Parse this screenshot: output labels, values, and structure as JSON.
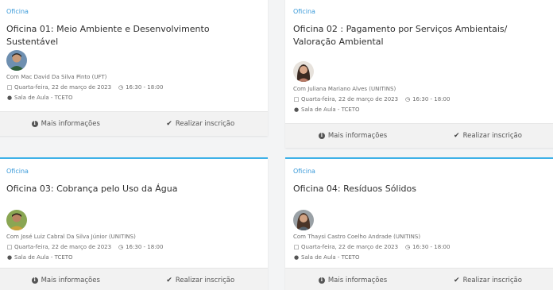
{
  "cards": [
    {
      "tag": "Oficina",
      "title": "Oficina 01: Meio Ambiente e Desenvolvimento Sustentável",
      "presenter": "Com Mac David Da Silva Pinto (UFT)",
      "date": "Quarta-feira, 22 de março de 2023",
      "time": "16:30 - 18:00",
      "location": "Sala de Aula - TCETO",
      "more_info": "Mais informações",
      "register": "Realizar inscrição"
    },
    {
      "tag": "Oficina",
      "title": "Oficina 02 : Pagamento por Serviços Ambientais/ Valoração Ambiental",
      "presenter": "Com Juliana Mariano Alves (UNITINS)",
      "date": "Quarta-feira, 22 de março de 2023",
      "time": "16:30 - 18:00",
      "location": "Sala de Aula - TCETO",
      "more_info": "Mais informações",
      "register": "Realizar inscrição"
    },
    {
      "tag": "Oficina",
      "title": "Oficina 03: Cobrança pelo Uso da Água",
      "presenter": "Com José Luiz Cabral Da Silva Júnior (UNITINS)",
      "date": "Quarta-feira, 22 de março de 2023",
      "time": "16:30 - 18:00",
      "location": "Sala de Aula - TCETO",
      "more_info": "Mais informações",
      "register": "Realizar inscrição"
    },
    {
      "tag": "Oficina",
      "title": "Oficina 04: Resíduos Sólidos",
      "presenter": "Com Thaysi Castro Coelho Andrade (UNITINS)",
      "date": "Quarta-feira, 22 de março de 2023",
      "time": "16:30 - 18:00",
      "location": "Sala de Aula - TCETO",
      "more_info": "Mais informações",
      "register": "Realizar inscrição"
    }
  ],
  "icons": {
    "calendar": "calendar-icon",
    "clock": "clock-icon",
    "location": "map-marker-icon",
    "info": "info-circle-icon",
    "check": "check-icon"
  },
  "colors": {
    "accent": "#3eb1e8",
    "tag": "#3a9ad9",
    "footer_bg": "#f2f2f2"
  }
}
